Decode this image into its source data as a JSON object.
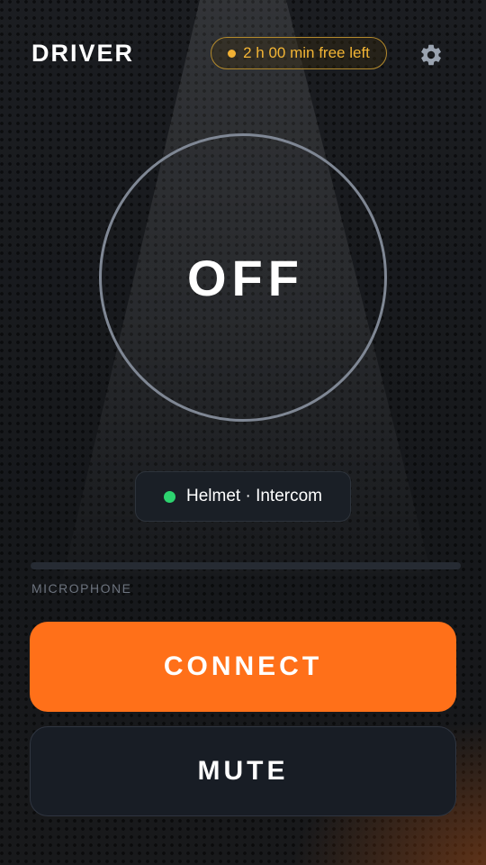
{
  "header": {
    "title": "DRIVER",
    "free_time": "2 h 00 min free left",
    "settings_icon": "gear-icon"
  },
  "status": {
    "state": "OFF"
  },
  "device": {
    "label": "Helmet · Intercom",
    "connected": true
  },
  "microphone": {
    "label": "MICROPHONE",
    "level_percent": 0
  },
  "actions": {
    "connect_label": "CONNECT",
    "mute_label": "MUTE"
  },
  "colors": {
    "accent": "#ff7019",
    "timer": "#f3b535",
    "device_ok": "#2dd36f",
    "ring": "#7f8794"
  }
}
